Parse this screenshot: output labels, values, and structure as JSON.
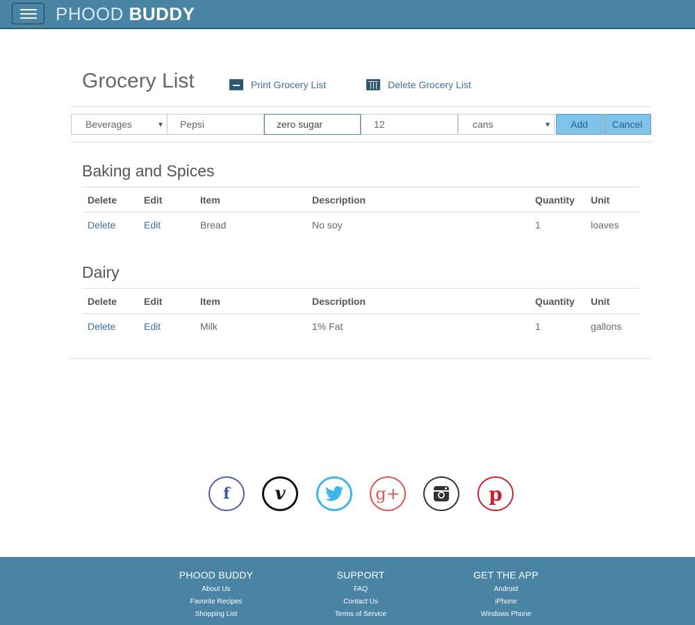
{
  "header": {
    "brand_light": "PHOOD",
    "brand_bold": "BUDDY"
  },
  "page": {
    "title": "Grocery List",
    "print_label": "Print Grocery List",
    "delete_label": "Delete Grocery List"
  },
  "form": {
    "category": "Beverages",
    "item": "Pepsi",
    "description": "zero sugar",
    "quantity": "12",
    "unit": "cans",
    "add_label": "Add",
    "cancel_label": "Cancel"
  },
  "table_headers": [
    "Delete",
    "Edit",
    "Item",
    "Description",
    "Quantity",
    "Unit"
  ],
  "sections": [
    {
      "title": "Baking and Spices",
      "rows": [
        {
          "delete": "Delete",
          "edit": "Edit",
          "item": "Bread",
          "description": "No soy",
          "quantity": "1",
          "unit": "loaves"
        }
      ]
    },
    {
      "title": "Dairy",
      "rows": [
        {
          "delete": "Delete",
          "edit": "Edit",
          "item": "Milk",
          "description": "1% Fat",
          "quantity": "1",
          "unit": "gallons"
        }
      ]
    }
  ],
  "social": {
    "facebook": "f",
    "vimeo": "v",
    "googleplus": "g+",
    "pinterest": "p",
    "icons": [
      "facebook-icon",
      "vimeo-icon",
      "twitter-icon",
      "google-plus-icon",
      "instagram-icon",
      "pinterest-icon"
    ]
  },
  "footer": {
    "columns": [
      {
        "heading": "PHOOD BUDDY",
        "links": [
          "About Us",
          "Favorite Recipes",
          "Shopping List"
        ]
      },
      {
        "heading": "SUPPORT",
        "links": [
          "FAQ",
          "Contact Us",
          "Terms of Service"
        ]
      },
      {
        "heading": "GET THE APP",
        "links": [
          "Android",
          "iPhone",
          "Windows Phone"
        ]
      }
    ]
  },
  "colors": {
    "header_bg": "#4a84a5",
    "link": "#3b6fa0",
    "button_bg": "#7fc3e8"
  }
}
